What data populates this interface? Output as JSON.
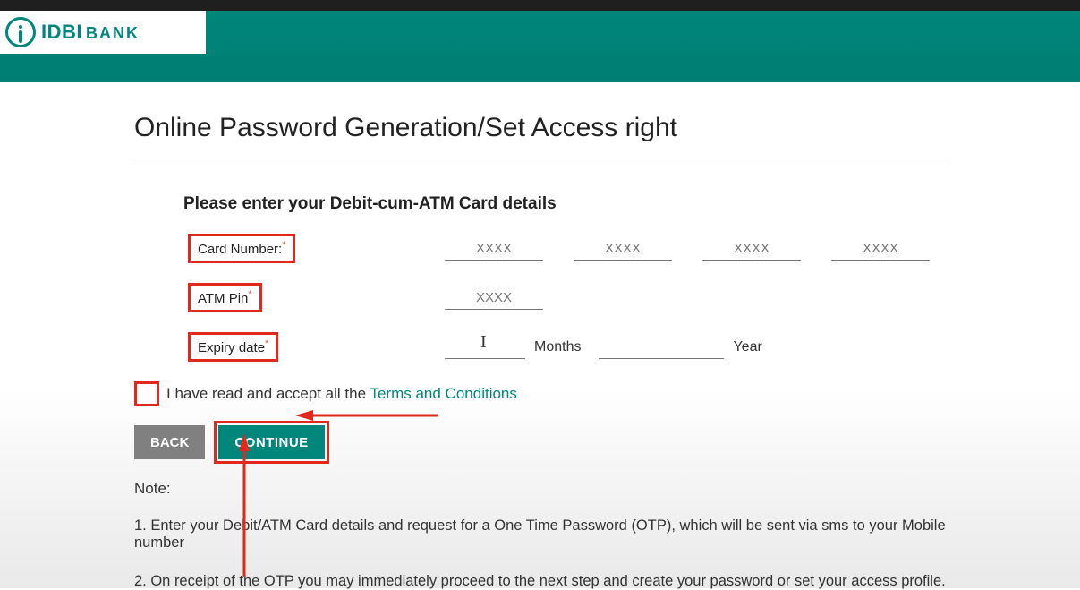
{
  "brand": {
    "name": "IDBI",
    "suffix": "BANK"
  },
  "page": {
    "title": "Online Password Generation/Set Access right",
    "section_heading": "Please enter your Debit-cum-ATM Card details"
  },
  "labels": {
    "card_number": "Card Number:",
    "atm_pin": "ATM Pin",
    "expiry_date": "Expiry date",
    "required_mark": "*",
    "months": "Months",
    "year": "Year"
  },
  "placeholders": {
    "xxxx": "XXXX"
  },
  "terms": {
    "prefix": "I have read and accept all the ",
    "link": "Terms and Conditions"
  },
  "buttons": {
    "back": "BACK",
    "continue": "CONTINUE"
  },
  "notes": {
    "title": "Note:",
    "n1": "1. Enter your Debit/ATM Card details and request for a One Time Password (OTP), which will be sent via sms to your Mobile number",
    "n2": "2. On receipt of the OTP you may immediately proceed to the next step and create your password or set your access profile."
  }
}
